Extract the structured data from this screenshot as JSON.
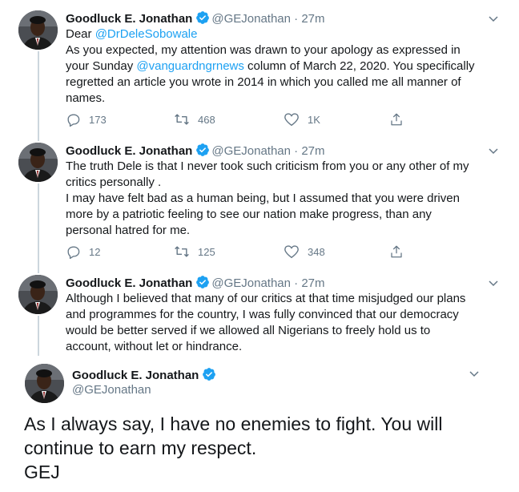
{
  "author": {
    "name": "Goodluck E. Jonathan",
    "handle": "@GEJonathan",
    "dot": "·",
    "time": "27m"
  },
  "tweets": [
    {
      "line1_pre": "Dear ",
      "line1_link": "@DrDeleSobowale",
      "line2": "As you expected, my attention was drawn to your apology as expressed in",
      "line3_pre": "your Sunday ",
      "line3_link": "@vanguardngrnews",
      "line3_post": " column of March 22, 2020. You specifically",
      "line4": "regretted an article you wrote in 2014 in which you called me all manner of",
      "line5": "names.",
      "replies": "173",
      "retweets": "468",
      "likes": "1K"
    },
    {
      "line1": "The truth Dele is that I never took such criticism from you or any other of my",
      "line2": "critics personally .",
      "line3": "I may have felt bad as a human being, but I assumed that you were driven",
      "line4": "more by a patriotic feeling to see our nation make progress, than any",
      "line5": "personal hatred for me.",
      "replies": "12",
      "retweets": "125",
      "likes": "348"
    },
    {
      "line1": "Although I believed that many of our critics at that time misjudged our plans",
      "line2": "and programmes for the country, I was fully convinced that our democracy",
      "line3": "would be better served if we allowed all Nigerians to freely hold us to",
      "line4": "account, without let or hindrance."
    }
  ],
  "main_tweet": {
    "line1": "As I always say, I have no enemies to fight. You will",
    "line2": "continue to earn my respect.",
    "line3": "GEJ"
  },
  "colors": {
    "link": "#1da1f2",
    "verified": "#1da1f2",
    "muted": "#657786",
    "thread_line": "#ccd6dd"
  }
}
